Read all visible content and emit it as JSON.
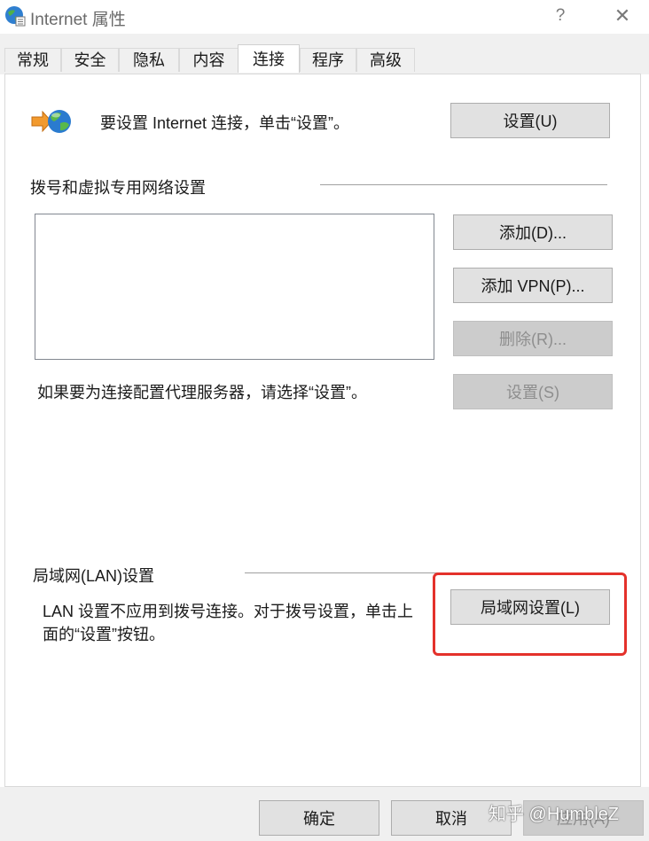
{
  "window": {
    "title": "Internet 属性",
    "help_glyph": "?",
    "close_glyph": "✕"
  },
  "tabs": [
    {
      "label": "常规",
      "active": false
    },
    {
      "label": "安全",
      "active": false
    },
    {
      "label": "隐私",
      "active": false
    },
    {
      "label": "内容",
      "active": false
    },
    {
      "label": "连接",
      "active": true
    },
    {
      "label": "程序",
      "active": false
    },
    {
      "label": "高级",
      "active": false
    }
  ],
  "setup": {
    "text": "要设置 Internet 连接，单击“设置”。",
    "button": "设置(U)",
    "button_key": "U"
  },
  "dialup": {
    "heading": "拨号和虚拟专用网络设置",
    "buttons": {
      "add": "添加(D)...",
      "add_vpn": "添加 VPN(P)...",
      "remove": "删除(R)...",
      "settings": "设置(S)"
    },
    "proxy_text": "如果要为连接配置代理服务器，请选择“设置”。"
  },
  "lan": {
    "heading": "局域网(LAN)设置",
    "text_line1": "LAN 设置不应用到拨号连接。对于拨号设置，单击上",
    "text_line2": "面的“设置”按钮。",
    "button": "局域网设置(L)"
  },
  "footer": {
    "ok": "确定",
    "cancel": "取消",
    "apply": "应用(A)"
  },
  "watermark": "知乎 @HumbleZ",
  "colors": {
    "highlight": "#e4312b",
    "tab_bg": "#f0f0f0",
    "button_bg": "#e1e1e1",
    "disabled_bg": "#cccccc"
  }
}
